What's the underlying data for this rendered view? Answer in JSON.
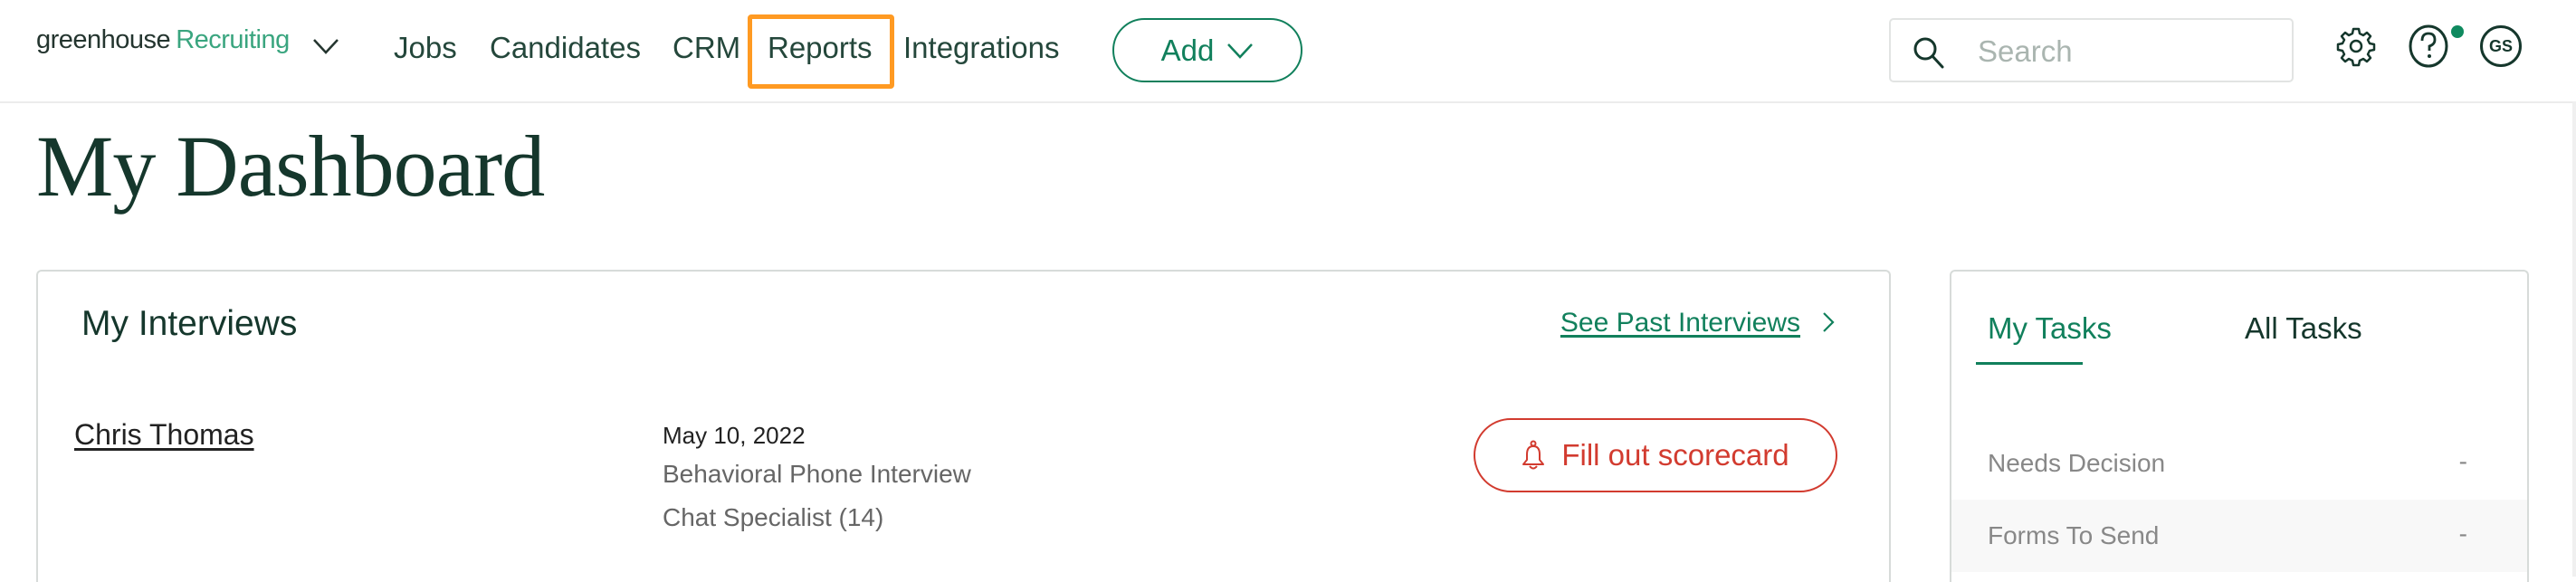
{
  "header": {
    "logo_primary": "greenhouse",
    "logo_secondary": "Recruiting",
    "nav": [
      "Jobs",
      "Candidates",
      "CRM",
      "Reports",
      "Integrations"
    ],
    "highlighted_nav": "Reports",
    "add_label": "Add",
    "search_placeholder": "Search",
    "avatar_initials": "GS",
    "icons": [
      "chevron-down-icon",
      "search-icon",
      "gear-icon",
      "help-icon",
      "avatar"
    ],
    "colors": {
      "accent": "#11805c",
      "highlight": "#ff9a22",
      "alert": "#d23b2f"
    }
  },
  "page": {
    "title": "My Dashboard"
  },
  "interviews": {
    "title": "My Interviews",
    "past_link": "See Past Interviews",
    "items": [
      {
        "candidate": "Chris Thomas",
        "date": "May 10, 2022",
        "type": "Behavioral Phone Interview",
        "job": "Chat Specialist (14)",
        "action": "Fill out scorecard"
      }
    ]
  },
  "tasks": {
    "tabs": [
      "My Tasks",
      "All Tasks"
    ],
    "active_tab": "My Tasks",
    "rows": [
      {
        "label": "Needs Decision",
        "count": "-"
      },
      {
        "label": "Forms To Send",
        "count": "-"
      }
    ]
  }
}
